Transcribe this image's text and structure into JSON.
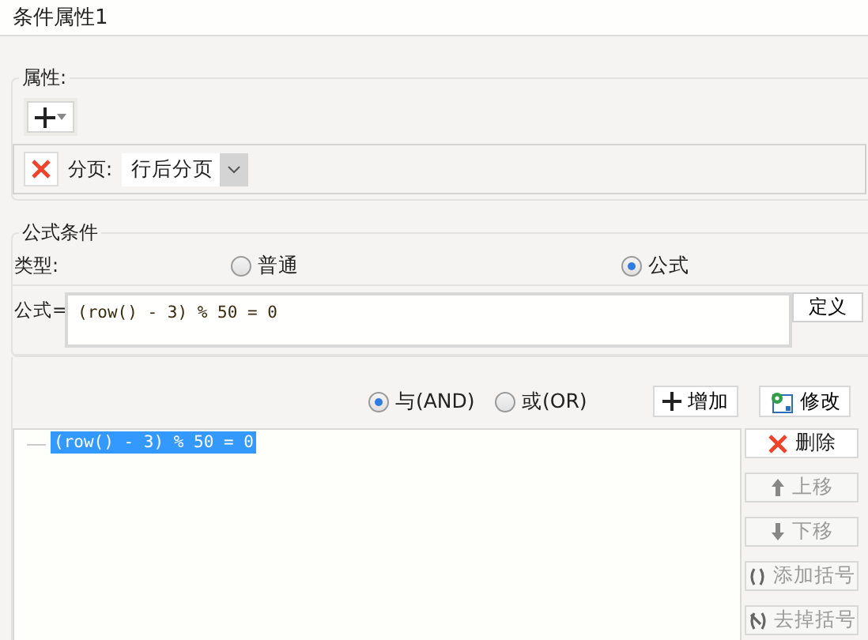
{
  "window": {
    "title": "条件属性1"
  },
  "properties": {
    "legend": "属性:",
    "page_break": {
      "label": "分页:",
      "value": "行后分页"
    }
  },
  "formula_condition": {
    "legend": "公式条件",
    "type_label": "类型:",
    "type_options": [
      {
        "label": "普通",
        "selected": false
      },
      {
        "label": "公式",
        "selected": true
      }
    ],
    "formula_label": "公式=",
    "formula_value": "(row() - 3) % 50 = 0",
    "define_button": "定义"
  },
  "logic_options": [
    {
      "label": "与(AND)",
      "selected": true
    },
    {
      "label": "或(OR)",
      "selected": false
    }
  ],
  "toolbar_buttons": [
    {
      "label": "增加",
      "kind": "add"
    },
    {
      "label": "修改",
      "kind": "edit"
    }
  ],
  "conditions": [
    {
      "text": "(row() - 3) % 50 = 0",
      "selected": true
    }
  ],
  "side_buttons": [
    {
      "label": "删除",
      "kind": "delete",
      "disabled": false
    },
    {
      "label": "上移",
      "kind": "up",
      "disabled": true
    },
    {
      "label": "下移",
      "kind": "down",
      "disabled": true
    },
    {
      "label": "添加括号",
      "kind": "add-paren",
      "disabled": true
    },
    {
      "label": "去掉括号",
      "kind": "remove-paren",
      "disabled": true
    }
  ]
}
